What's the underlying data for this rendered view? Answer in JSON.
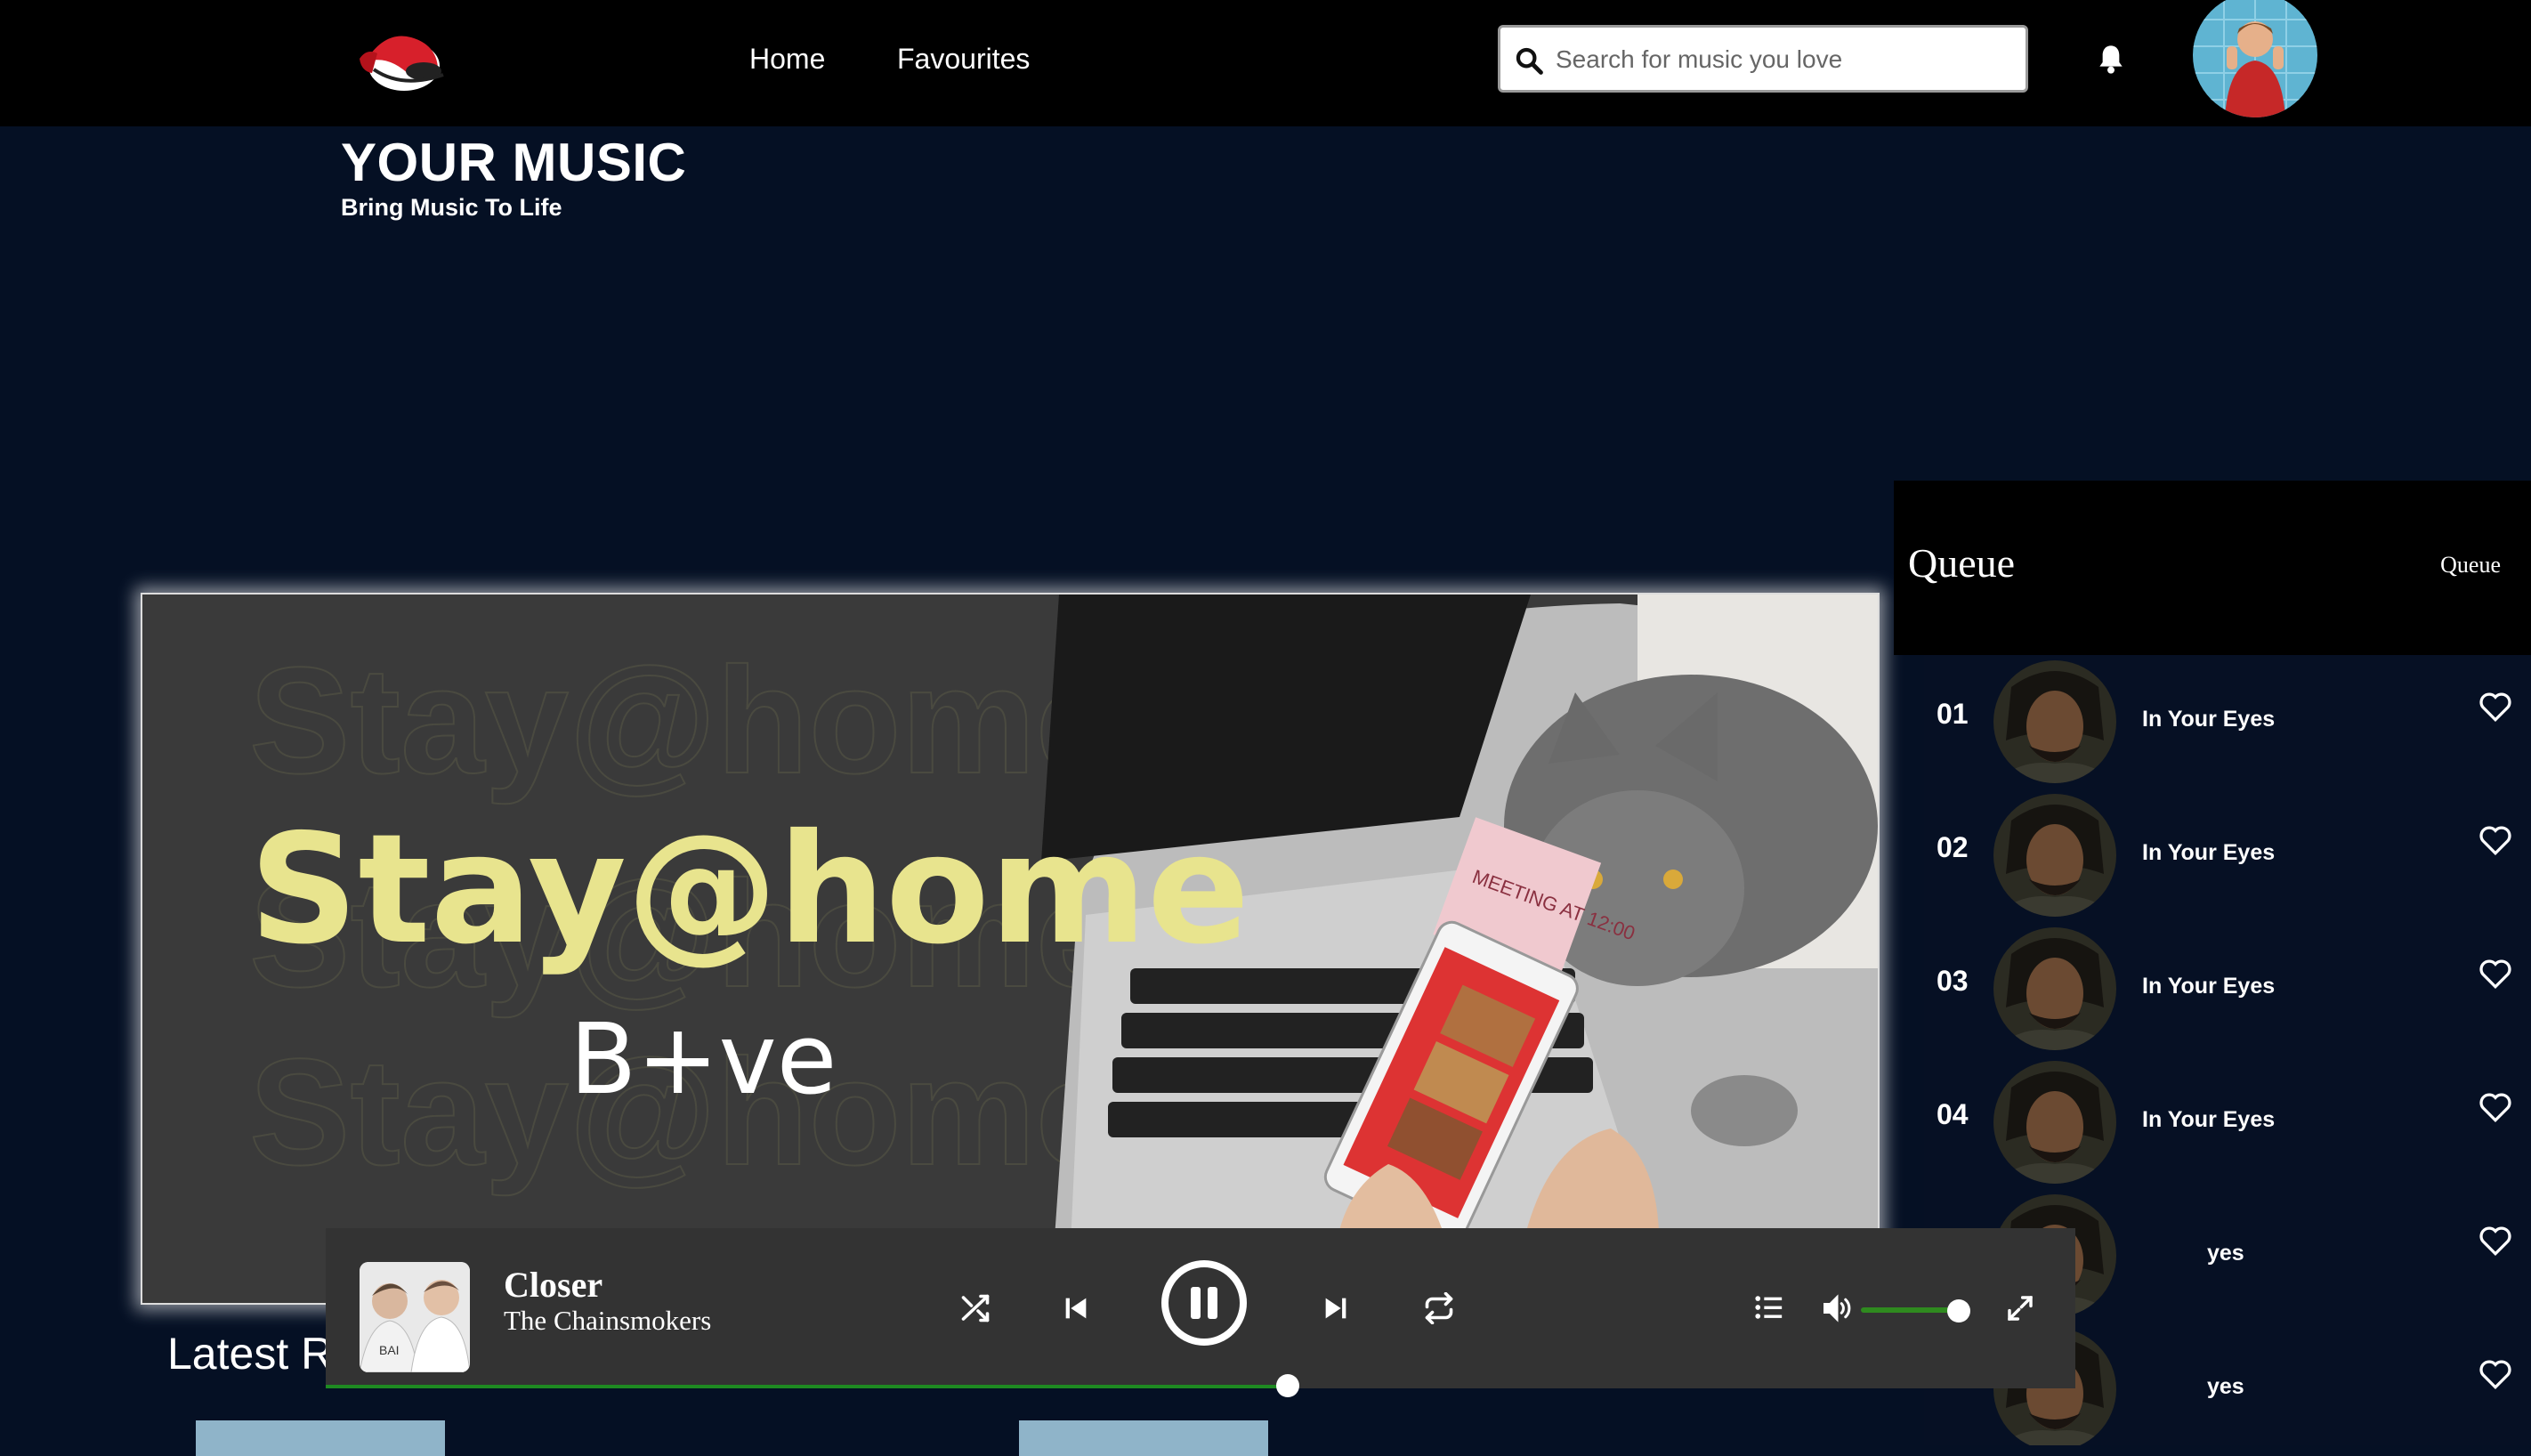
{
  "nav": {
    "home": "Home",
    "favourites": "Favourites",
    "search_placeholder": "Search for music you love"
  },
  "header": {
    "title": "YOUR MUSIC",
    "subtitle": "Bring Music To Life"
  },
  "banner": {
    "headline": "Stay@home",
    "subline": "B+ve",
    "note": "MEETING AT 12:00"
  },
  "latest": {
    "title": "Latest R"
  },
  "queue": {
    "title": "Queue",
    "tab_label": "Queue",
    "items": [
      {
        "num": "01",
        "title": "In Your Eyes"
      },
      {
        "num": "02",
        "title": "In Your Eyes"
      },
      {
        "num": "03",
        "title": "In Your Eyes"
      },
      {
        "num": "04",
        "title": "In Your Eyes"
      },
      {
        "num": "",
        "title": "yes"
      },
      {
        "num": "",
        "title": "yes"
      }
    ]
  },
  "player": {
    "track_title": "Closer",
    "artist": "The Chainsmokers",
    "progress": 0.55,
    "volume": 0.92
  },
  "colors": {
    "page_bg": "#051024",
    "topbar_bg": "#000000",
    "player_bg": "#333333",
    "accent_green": "#1e8a22",
    "banner_yellow": "#e8e48e"
  },
  "icons": [
    "logo-icon",
    "search-icon",
    "bell-icon",
    "heart-icon",
    "shuffle-icon",
    "previous-icon",
    "pause-icon",
    "next-icon",
    "repeat-icon",
    "queue-list-icon",
    "volume-icon",
    "expand-icon"
  ]
}
